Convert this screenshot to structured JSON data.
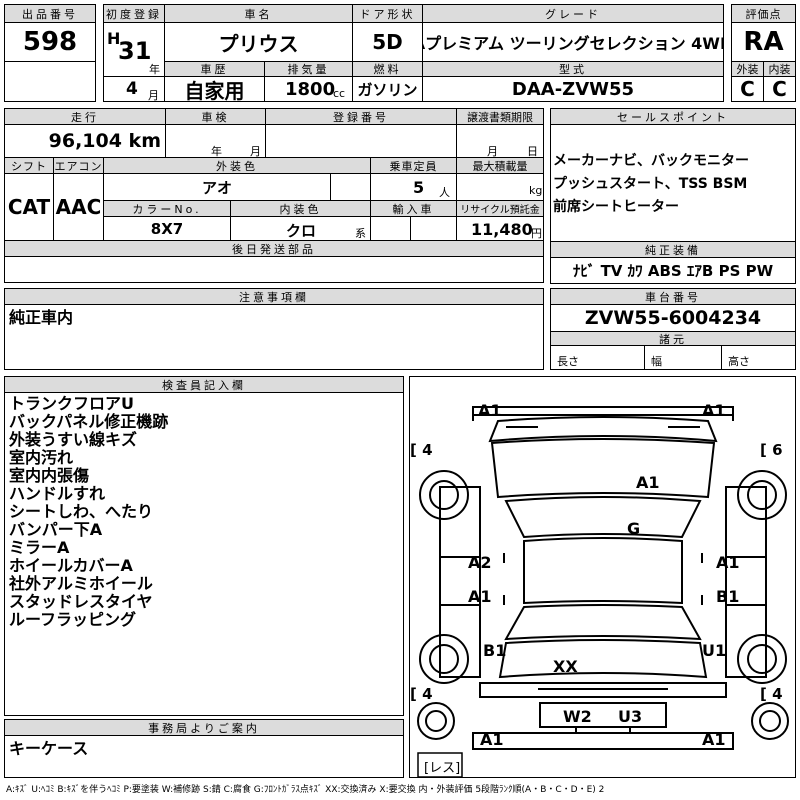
{
  "header": {
    "lot_no_label": "出品番号",
    "lot_no": "598",
    "first_reg_label": "初度登録",
    "era": "H",
    "year": "31",
    "year_unit": "年",
    "month": "4",
    "month_unit": "月",
    "car_name_label": "車名",
    "car_name": "プリウス",
    "door_label": "ドア形状",
    "door": "5D",
    "grade_label": "グレード",
    "grade": "Aプレミアム ツーリングセレクション 4WD",
    "score_label": "評価点",
    "score": "RA",
    "history_label": "車歴",
    "history": "自家用",
    "displacement_label": "排気量",
    "displacement": "1800",
    "displacement_unit": "cc",
    "fuel_label": "燃料",
    "fuel": "ガソリン",
    "model_label": "型式",
    "model": "DAA-ZVW55",
    "ext_grade_label": "外装",
    "ext_grade": "C",
    "int_grade_label": "内装",
    "int_grade": "C"
  },
  "row2": {
    "mileage_label": "走行",
    "mileage": "96,104 km",
    "inspection_label": "車検",
    "inspection_year_unit": "年",
    "inspection_month_unit": "月",
    "plate_label": "登録番号",
    "transfer_label": "譲渡書類期限",
    "transfer_month_unit": "月",
    "transfer_day_unit": "日",
    "shift_label": "シフト",
    "shift": "CAT",
    "ac_label": "エアコン",
    "ac": "AAC",
    "color_label": "外装色",
    "color": "アオ",
    "capacity_label": "乗車定員",
    "capacity": "5",
    "capacity_unit": "人",
    "load_label": "最大積載量",
    "load_unit": "kg",
    "color_no_label": "カラーNo.",
    "color_no": "8X7",
    "interior_color_label": "内装色",
    "interior_color": "クロ",
    "interior_color_unit": "系",
    "import_label": "輸入車",
    "recycle_label": "リサイクル預託金",
    "recycle": "11,480",
    "recycle_unit": "円",
    "later_label": "後日発送部品"
  },
  "sales": {
    "label": "セールスポイント",
    "lines": [
      "メーカーナビ、バックモニター",
      "プッシュスタート、TSS BSM",
      "前席シートヒーター"
    ]
  },
  "equipment": {
    "label": "純正装備",
    "items": "ﾅﾋﾞ TV ｶﾜ ABS ｴｱB PS PW"
  },
  "notes": {
    "label": "注意事項欄",
    "text": "純正車内"
  },
  "chassis": {
    "label": "車台番号",
    "number": "ZVW55-6004234",
    "dims_label": "諸元",
    "length_label": "長さ",
    "width_label": "幅",
    "height_label": "高さ"
  },
  "inspector": {
    "label": "検査員記入欄",
    "lines": [
      "トランクフロアU",
      "バックパネル修正機跡",
      "外装うすい線キズ",
      "室内汚れ",
      "室内内張傷",
      "ハンドルすれ",
      "シートしわ、へたり",
      "バンパー下A",
      "ミラーA",
      "ホイールカバーA",
      "社外アルミホイール",
      "スタッドレスタイヤ",
      "ルーフラッピング"
    ]
  },
  "office": {
    "label": "事務局よりご案内",
    "text": "キーケース"
  },
  "diagram": {
    "marks": {
      "top_left": "A1",
      "top_right": "A1",
      "roof": "A1",
      "glass": "G",
      "left_front_door": "A2",
      "right_front_door": "A1",
      "left_rear_door": "A1",
      "right_rear_door": "B1",
      "left_quarter": "B1",
      "right_quarter": "U1",
      "trunk": "XX",
      "rear_left": "W2",
      "rear_right": "U3",
      "bottom_left": "A1",
      "bottom_right": "A1"
    },
    "tires": {
      "front_left": "4",
      "front_right": "6",
      "rear_left": "4",
      "rear_right": "4"
    },
    "spare": "レス"
  },
  "legend": "A:ｷｽﾞ U:ﾍｺﾐ B:ｷｽﾞを伴うﾍｺﾐ P:要塗装 W:補修跡 S:錆 C:腐食 G:ﾌﾛﾝﾄｶﾞﾗｽ点ｷｽﾞ XX:交換済み X:要交換 内・外装評価 5段階ﾗﾝｸ順(A・B・C・D・E) 2"
}
